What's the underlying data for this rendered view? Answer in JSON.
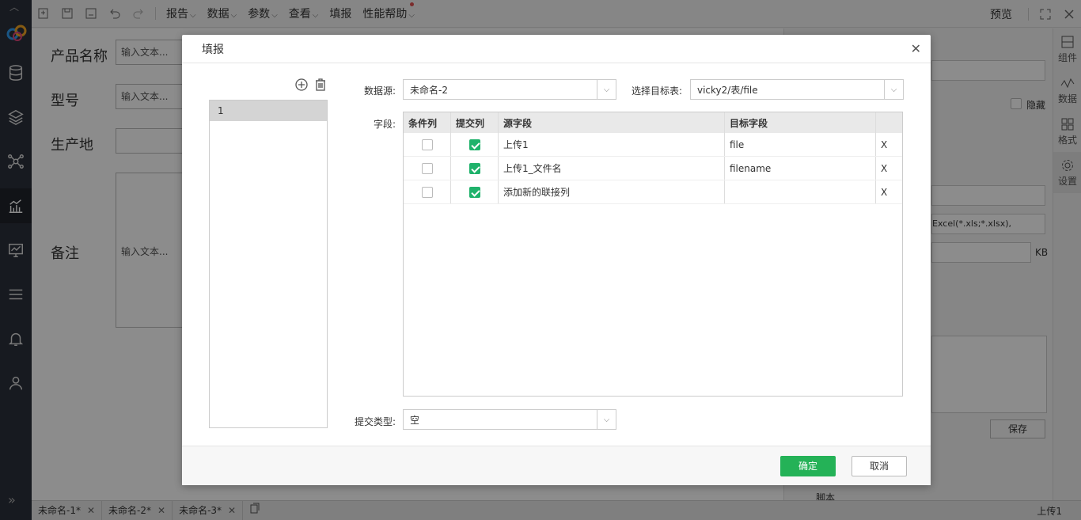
{
  "toolbar": {
    "menus": [
      "报告",
      "数据",
      "参数",
      "查看",
      "填报",
      "性能帮助"
    ],
    "preview": "预览"
  },
  "canvas": {
    "labels": [
      "产品名称",
      "型号",
      "生产地",
      "备注"
    ],
    "placeholder": "输入文本..."
  },
  "rightpanel": {
    "hide_label": "隐藏",
    "file_types": "Excel(*.xls;*.xlsx),",
    "size_unit": "KB",
    "save_label": "保存",
    "script_label": "脚本"
  },
  "sidetabs": [
    "组件",
    "数据",
    "格式",
    "设置"
  ],
  "bottom_tabs": [
    "未命名-1*",
    "未命名-2*",
    "未命名-3*"
  ],
  "status_right": "上传1",
  "dialog": {
    "title": "填报",
    "list_items": [
      "1"
    ],
    "datasource_label": "数据源:",
    "datasource_value": "未命名-2",
    "target_label": "选择目标表:",
    "target_value": "vicky2/表/file",
    "fields_label": "字段:",
    "columns": [
      "条件列",
      "提交列",
      "源字段",
      "目标字段"
    ],
    "rows": [
      {
        "condition": false,
        "submit": true,
        "source": "上传1",
        "target": "file",
        "remove": "X"
      },
      {
        "condition": false,
        "submit": true,
        "source": "上传1_文件名",
        "target": "filename",
        "remove": "X"
      },
      {
        "condition": false,
        "submit": true,
        "source": "添加新的联接列",
        "target": "",
        "remove": "X"
      }
    ],
    "submit_type_label": "提交类型:",
    "submit_type_value": "空",
    "ok_label": "确定",
    "cancel_label": "取消"
  }
}
